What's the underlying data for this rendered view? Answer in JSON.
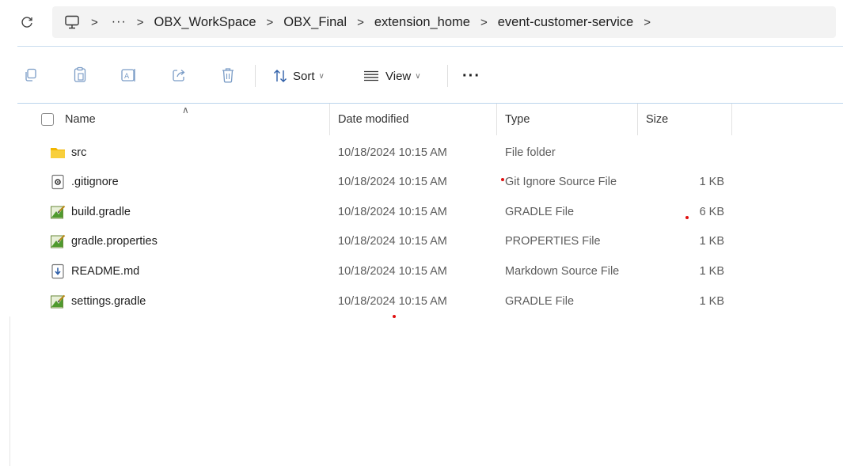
{
  "address_bar": {
    "breadcrumbs": [
      "OBX_WorkSpace",
      "OBX_Final",
      "extension_home",
      "event-customer-service"
    ],
    "overflow": "···",
    "separator": ">",
    "icons": [
      "refresh-icon",
      "this-pc-icon"
    ]
  },
  "toolbar": {
    "sort_label": "Sort",
    "view_label": "View",
    "more_label": "···",
    "icons": [
      "copy-icon",
      "paste-icon",
      "rename-icon",
      "share-icon",
      "delete-icon",
      "sort-icon",
      "view-icon"
    ]
  },
  "columns": {
    "name": "Name",
    "date_modified": "Date modified",
    "type": "Type",
    "size": "Size"
  },
  "files": [
    {
      "name": "src",
      "date": "10/18/2024 10:15 AM",
      "type": "File folder",
      "size": "",
      "icon": "folder-icon"
    },
    {
      "name": ".gitignore",
      "date": "10/18/2024 10:15 AM",
      "type": "Git Ignore Source File",
      "size": "1 KB",
      "icon": "settings-file-icon"
    },
    {
      "name": "build.gradle",
      "date": "10/18/2024 10:15 AM",
      "type": "GRADLE File",
      "size": "6 KB",
      "icon": "gradle-file-icon"
    },
    {
      "name": "gradle.properties",
      "date": "10/18/2024 10:15 AM",
      "type": "PROPERTIES File",
      "size": "1 KB",
      "icon": "gradle-file-icon"
    },
    {
      "name": "README.md",
      "date": "10/18/2024 10:15 AM",
      "type": "Markdown Source File",
      "size": "1 KB",
      "icon": "markdown-file-icon"
    },
    {
      "name": "settings.gradle",
      "date": "10/18/2024 10:15 AM",
      "type": "GRADLE File",
      "size": "1 KB",
      "icon": "gradle-file-icon"
    }
  ],
  "colors": {
    "accent": "#7a9cc6",
    "folder": "#f5c542",
    "marker": "#e01010"
  }
}
